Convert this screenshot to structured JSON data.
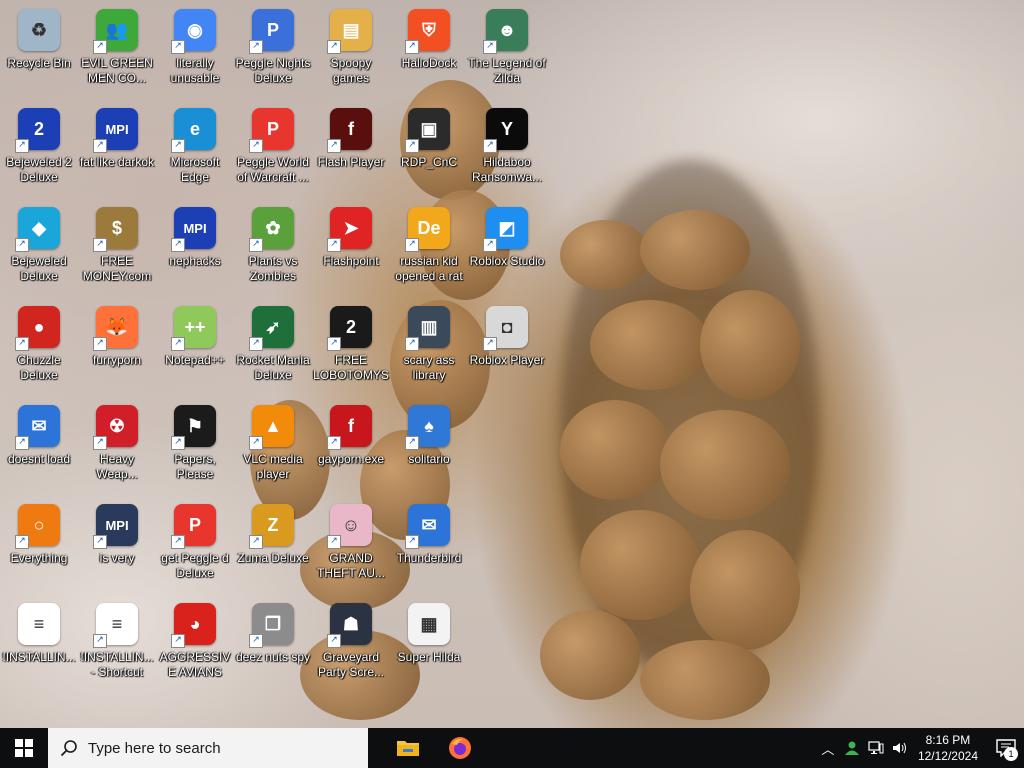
{
  "desktop": {
    "columns": [
      [
        {
          "label": "Recycle Bin",
          "icon": "recycle-bin-icon",
          "color": "#9fb6c9",
          "glyph": "♻",
          "shortcut": false
        },
        {
          "label": "Bejeweled 2 Deluxe",
          "icon": "bejeweled2-icon",
          "color": "#1d3fb5",
          "glyph": "2",
          "shortcut": true
        },
        {
          "label": "Bejeweled Deluxe",
          "icon": "bejeweled-gem-icon",
          "color": "#1aa6d9",
          "glyph": "◆",
          "shortcut": true
        },
        {
          "label": "Chuzzle Deluxe",
          "icon": "chuzzle-icon",
          "color": "#d1261f",
          "glyph": "●",
          "shortcut": true
        },
        {
          "label": "doesnt load",
          "icon": "thunderbird-icon",
          "color": "#2d74d9",
          "glyph": "✉",
          "shortcut": true
        },
        {
          "label": "Everything",
          "icon": "everything-search-icon",
          "color": "#f07a12",
          "glyph": "○",
          "shortcut": true
        },
        {
          "label": "!INSTALLIN...",
          "icon": "text-document-icon",
          "color": "#ffffff",
          "glyph": "≡",
          "shortcut": false
        }
      ],
      [
        {
          "label": "EVIL GREEN MEN CO...",
          "icon": "green-men-icon",
          "color": "#3fa83b",
          "glyph": "👥",
          "shortcut": true
        },
        {
          "label": "fat like darkok",
          "icon": "mpi-logo-icon",
          "color": "#1d3fb5",
          "glyph": "MPI",
          "shortcut": true
        },
        {
          "label": "FREE MONEY.com",
          "icon": "money-bag-icon",
          "color": "#9c7a3c",
          "glyph": "$",
          "shortcut": true
        },
        {
          "label": "furryporn",
          "icon": "firefox-icon",
          "color": "#ff7139",
          "glyph": "🦊",
          "shortcut": true
        },
        {
          "label": "Heavy Weap...",
          "icon": "radiation-icon",
          "color": "#d11f2a",
          "glyph": "☢",
          "shortcut": true
        },
        {
          "label": "is very",
          "icon": "mpi-shield-icon",
          "color": "#2a3a5c",
          "glyph": "MPI",
          "shortcut": true
        },
        {
          "label": "!INSTALLIN... - Shortcut",
          "icon": "text-document-icon",
          "color": "#ffffff",
          "glyph": "≡",
          "shortcut": true
        }
      ],
      [
        {
          "label": "literally unusable",
          "icon": "chrome-icon",
          "color": "#4285f4",
          "glyph": "◉",
          "shortcut": true
        },
        {
          "label": "Microsoft Edge",
          "icon": "edge-icon",
          "color": "#1a8fd6",
          "glyph": "e",
          "shortcut": true
        },
        {
          "label": "nephacks",
          "icon": "mpi-logo-icon",
          "color": "#1d3fb5",
          "glyph": "MPI",
          "shortcut": true
        },
        {
          "label": "Notepad++",
          "icon": "notepad-plus-plus-icon",
          "color": "#8fc95c",
          "glyph": "++",
          "shortcut": true
        },
        {
          "label": "Papers, Please",
          "icon": "papers-please-icon",
          "color": "#1b1b1b",
          "glyph": "⚑",
          "shortcut": true
        },
        {
          "label": "get Peggle d Deluxe",
          "icon": "peggle-icon",
          "color": "#e8362f",
          "glyph": "P",
          "shortcut": true
        },
        {
          "label": "AGGRESSIVE AVIANS",
          "icon": "angry-bird-icon",
          "color": "#d9221c",
          "glyph": "◕",
          "shortcut": true
        }
      ],
      [
        {
          "label": "Peggle Nights Deluxe",
          "icon": "peggle-nights-icon",
          "color": "#3b6fd9",
          "glyph": "P",
          "shortcut": true
        },
        {
          "label": "Peggle World of Warcraft ...",
          "icon": "peggle-wow-icon",
          "color": "#e8362f",
          "glyph": "P",
          "shortcut": true
        },
        {
          "label": "Plants vs Zombies",
          "icon": "plants-vs-zombies-icon",
          "color": "#5aa13b",
          "glyph": "✿",
          "shortcut": true
        },
        {
          "label": "Rocket Mania Deluxe",
          "icon": "rocket-mania-icon",
          "color": "#1f6f3a",
          "glyph": "➶",
          "shortcut": true
        },
        {
          "label": "VLC media player",
          "icon": "vlc-cone-icon",
          "color": "#f28a0a",
          "glyph": "▲",
          "shortcut": true
        },
        {
          "label": "Zuma Deluxe",
          "icon": "zuma-icon",
          "color": "#d99a1f",
          "glyph": "Z",
          "shortcut": true
        },
        {
          "label": "deez nuts spy",
          "icon": "stacked-windows-icon",
          "color": "#8c8c8c",
          "glyph": "❐",
          "shortcut": true
        }
      ],
      [
        {
          "label": "Spoopy games",
          "icon": "folder-games-icon",
          "color": "#e3b04a",
          "glyph": "▤",
          "shortcut": true
        },
        {
          "label": "Flash Player",
          "icon": "flash-player-icon",
          "color": "#5a0f0f",
          "glyph": "f",
          "shortcut": true
        },
        {
          "label": "Flashpoint",
          "icon": "flashpoint-icon",
          "color": "#e02424",
          "glyph": "➤",
          "shortcut": true
        },
        {
          "label": "FREE LOBOTOMYS",
          "icon": "lobotomy-icon",
          "color": "#1a1a1a",
          "glyph": "2",
          "shortcut": true
        },
        {
          "label": "gayporn.exe",
          "icon": "flash-red-icon",
          "color": "#c8161d",
          "glyph": "f",
          "shortcut": true
        },
        {
          "label": "GRAND THEFT AU...",
          "icon": "anime-girl-icon",
          "color": "#e9b7c8",
          "glyph": "☺",
          "shortcut": true
        },
        {
          "label": "Graveyard Party Scre...",
          "icon": "graveyard-icon",
          "color": "#2b3242",
          "glyph": "☗",
          "shortcut": true
        }
      ],
      [
        {
          "label": "HalloDock",
          "icon": "windows-shield-icon",
          "color": "#f25022",
          "glyph": "⛨",
          "shortcut": true
        },
        {
          "label": "RDP_CnC",
          "icon": "remote-desktop-icon",
          "color": "#2b2b2b",
          "glyph": "▣",
          "shortcut": true
        },
        {
          "label": "russian kid opened a rat",
          "icon": "de-logo-icon",
          "color": "#f2a81a",
          "glyph": "De",
          "shortcut": true
        },
        {
          "label": "scary ass library",
          "icon": "library-icon",
          "color": "#3b4a5a",
          "glyph": "▥",
          "shortcut": true
        },
        {
          "label": "solitario",
          "icon": "solitaire-icon",
          "color": "#2f78d6",
          "glyph": "♠",
          "shortcut": true
        },
        {
          "label": "Thunderbird",
          "icon": "thunderbird-icon",
          "color": "#2d74d9",
          "glyph": "✉",
          "shortcut": true
        },
        {
          "label": "Super Hilda",
          "icon": "pixel-dog-icon",
          "color": "#f3f3f3",
          "glyph": "▦",
          "shortcut": false
        }
      ],
      [
        {
          "label": "The Legend of Zilda",
          "icon": "pixel-hero-icon",
          "color": "#3a7d5b",
          "glyph": "☻",
          "shortcut": true
        },
        {
          "label": "Hildaboo Ransomwa...",
          "icon": "yashma-icon",
          "color": "#0b0b0b",
          "glyph": "Y",
          "shortcut": true
        },
        {
          "label": "Roblox Studio",
          "icon": "roblox-studio-icon",
          "color": "#1f8ef1",
          "glyph": "◩",
          "shortcut": true
        },
        {
          "label": "Roblox Player",
          "icon": "roblox-player-icon",
          "color": "#d8d8d8",
          "glyph": "◘",
          "shortcut": true
        }
      ]
    ]
  },
  "taskbar": {
    "search_placeholder": "Type here to search",
    "pinned": [
      {
        "name": "file-explorer",
        "icon": "folder-icon"
      },
      {
        "name": "firefox",
        "icon": "firefox-icon"
      }
    ],
    "tray": {
      "time": "8:16 PM",
      "date": "12/12/2024",
      "notification_count": "1"
    }
  },
  "colors": {
    "taskbar_bg": "#0d0e10",
    "search_bg": "#f3f3f3",
    "windows_blue": "#0078d7"
  }
}
